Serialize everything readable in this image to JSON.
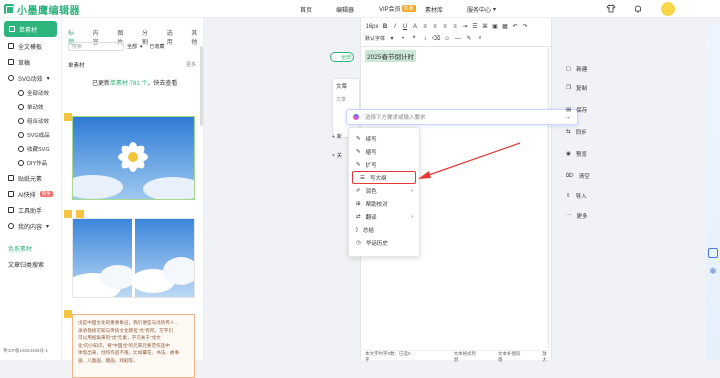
{
  "app": {
    "name": "小墨鹰编辑器"
  },
  "nav": {
    "home": "首页",
    "editor": "编辑器",
    "vip": "VIP会员",
    "vip_badge": "优惠",
    "materials": "素材库",
    "service": "服务中心",
    "service_arrow": "▾"
  },
  "sidebar": {
    "items": [
      {
        "label": "单素材"
      },
      {
        "label": "全文模板"
      },
      {
        "label": "草稿"
      },
      {
        "label": "SVG动效"
      },
      {
        "label": "全部动效"
      },
      {
        "label": "单动效"
      },
      {
        "label": "组合动效"
      },
      {
        "label": "SVG成品"
      },
      {
        "label": "收藏SVG"
      },
      {
        "label": "DIY作品"
      },
      {
        "label": "贴纸元素"
      },
      {
        "label": "AI快排",
        "badge": "限免"
      },
      {
        "label": "工具助手"
      },
      {
        "label": "我的内容"
      }
    ],
    "footer_links": [
      "色系素材",
      "文章归类搜索"
    ],
    "icp": "粤ICP备16024455号-1"
  },
  "materials": {
    "tabs": [
      "标题",
      "内容",
      "图片",
      "分割",
      "选用",
      "其他"
    ],
    "search_placeholder": "搜索",
    "filter_all": "全部",
    "filter_used": "已收藏",
    "section_title": "单素材",
    "more": "更多",
    "update_note_prefix": "已更新",
    "update_note_highlight": "单素材 781 个",
    "update_note_suffix": "，快去查看",
    "text_card_lines": [
      "戊是中国文化的重要象征，我们便是与戊的传人...",
      "承承我视可知与传统文化那名“戊”有所。写字们",
      "可以用视角来的“戊”元素，学习关于“戊文",
      "化”的小知识，将“中国戊”的元率元要范作品中",
      "体现出来，创作作品不限，比如霉花、书法、故事",
      "画、儿童画、版画、戏剧等。"
    ]
  },
  "editor": {
    "toolbar_row1": [
      "16px",
      "B",
      "I",
      "U",
      "A",
      "≡",
      "≡",
      "≡",
      "≡"
    ],
    "toolbar_row2": [
      "默认字体"
    ],
    "title_text": "2025春节倒计时",
    "ai_prompt_placeholder": "选择下方要求或输入要求",
    "status_left": "本文字约字0数：已选0字",
    "status_mid": "文本格式检测",
    "status_right": "文本补偿段落",
    "status_zoom": "放大"
  },
  "left_panel_items": {
    "back": "全部",
    "doc_title": "文章",
    "doc_sub": "文章",
    "add": "新",
    "close": "关"
  },
  "ai_menu": {
    "items": [
      {
        "label": "续写",
        "icon": "pen-icon"
      },
      {
        "label": "缩写",
        "icon": "pen-icon"
      },
      {
        "label": "扩写",
        "icon": "pen-icon"
      },
      {
        "label": "写大纲",
        "icon": "list-icon"
      },
      {
        "label": "润色",
        "icon": "brush-icon",
        "has_arrow": true
      },
      {
        "label": "帮助校对",
        "icon": "check-icon"
      },
      {
        "label": "翻译",
        "icon": "translate-icon",
        "has_arrow": true
      },
      {
        "label": "总结",
        "icon": "summary-icon"
      },
      {
        "label": "华话历史",
        "icon": "history-icon"
      }
    ]
  },
  "right_toolbar": {
    "items": [
      "新建",
      "复制",
      "保存",
      "同步",
      "预览",
      "清空",
      "导入",
      "更多"
    ]
  },
  "colors": {
    "brand": "#2db37c",
    "highlight": "#e53935",
    "arrow": "#e53935"
  }
}
